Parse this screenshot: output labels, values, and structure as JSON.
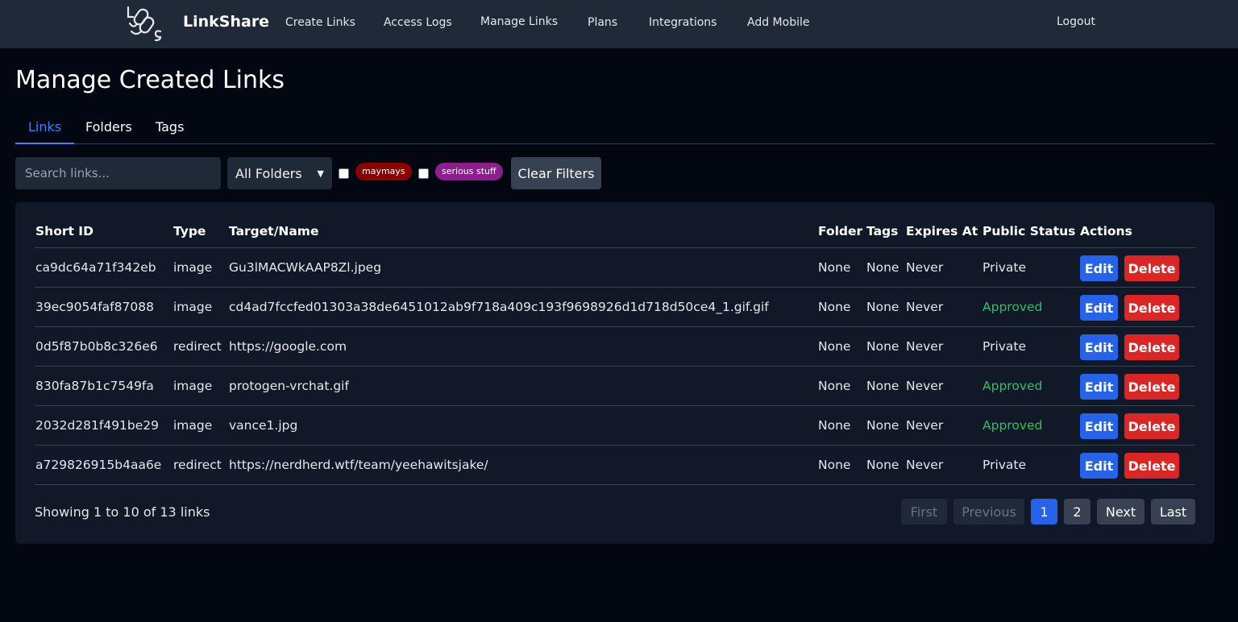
{
  "nav": {
    "brand": "LinkShare",
    "links": [
      "Create Links",
      "Access Logs",
      "Manage Links",
      "Plans",
      "Integrations",
      "Add Mobile"
    ],
    "logout": "Logout"
  },
  "page": {
    "title": "Manage Created Links"
  },
  "tabs": [
    "Links",
    "Folders",
    "Tags"
  ],
  "filters": {
    "search_placeholder": "Search links...",
    "folder_selected": "All Folders",
    "tags": [
      {
        "label": "maymays",
        "color": "#8b0000"
      },
      {
        "label": "serious stuff",
        "color": "#8e1e8e"
      }
    ],
    "clear": "Clear Filters"
  },
  "table": {
    "headers": [
      "Short ID",
      "Type",
      "Target/Name",
      "Folder",
      "Tags",
      "Expires At",
      "Public Status",
      "Actions"
    ],
    "rows": [
      {
        "id": "ca9dc64a71f342eb",
        "type": "image",
        "target": "Gu3lMACWkAAP8Zl.jpeg",
        "folder": "None",
        "tags": "None",
        "expires": "Never",
        "status": "Private"
      },
      {
        "id": "39ec9054faf87088",
        "type": "image",
        "target": "cd4ad7fccfed01303a38de6451012ab9f718a409c193f9698926d1d718d50ce4_1.gif.gif",
        "folder": "None",
        "tags": "None",
        "expires": "Never",
        "status": "Approved"
      },
      {
        "id": "0d5f87b0b8c326e6",
        "type": "redirect",
        "target": "https://google.com",
        "folder": "None",
        "tags": "None",
        "expires": "Never",
        "status": "Private"
      },
      {
        "id": "830fa87b1c7549fa",
        "type": "image",
        "target": "protogen-vrchat.gif",
        "folder": "None",
        "tags": "None",
        "expires": "Never",
        "status": "Approved"
      },
      {
        "id": "2032d281f491be29",
        "type": "image",
        "target": "vance1.jpg",
        "folder": "None",
        "tags": "None",
        "expires": "Never",
        "status": "Approved"
      },
      {
        "id": "a729826915b4aa6e",
        "type": "redirect",
        "target": "https://nerdherd.wtf/team/yeehawitsjake/",
        "folder": "None",
        "tags": "None",
        "expires": "Never",
        "status": "Private"
      }
    ],
    "edit_label": "Edit",
    "delete_label": "Delete"
  },
  "pagination": {
    "showing": "Showing 1 to 10 of 13 links",
    "first": "First",
    "previous": "Previous",
    "pages": [
      "1",
      "2"
    ],
    "next": "Next",
    "last": "Last"
  },
  "colors": {
    "accent": "#2563eb",
    "danger": "#dc2626",
    "approved": "#22c55e"
  }
}
